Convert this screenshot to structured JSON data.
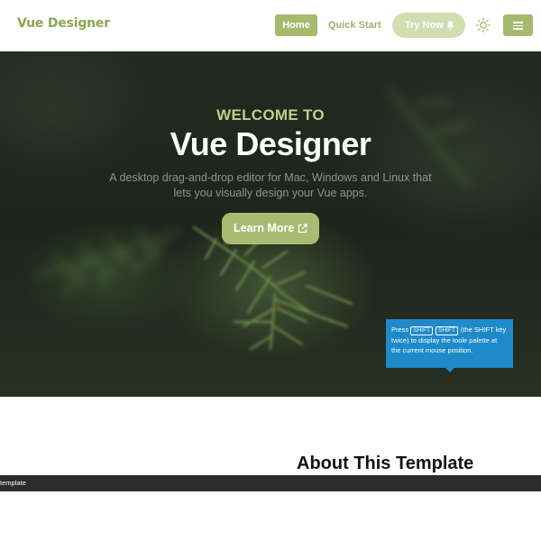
{
  "navbar": {
    "brand": "Vue Designer",
    "home_label": "Home",
    "quick_start_label": "Quick Start",
    "try_now_label": "Try Now",
    "menu_icon": "hamburger-icon",
    "theme_icon": "sun-icon",
    "try_now_icon": "bell-icon"
  },
  "hero": {
    "welcome": "WELCOME TO",
    "title": "Vue Designer",
    "description": "A desktop drag-and-drop editor for Mac, Windows and Linux that lets you visually design your Vue apps.",
    "learn_more_label": "Learn More",
    "learn_more_icon": "external-link-icon"
  },
  "tooltip": {
    "press": "Press",
    "key1": "SHIFT",
    "key2": "SHIFT",
    "rest": "(the SHIFT key twice) to display the toole palette at the current mouse position."
  },
  "content": {
    "about_title": "About This Template"
  },
  "status_bar": {
    "text": "template"
  },
  "colors": {
    "brand": "#8aa84f",
    "accent": "#a7b96b",
    "try_now_bg": "#d2ddb2",
    "tooltip_bg": "#1e8ac9",
    "status_bar_bg": "#2b2b2b"
  }
}
